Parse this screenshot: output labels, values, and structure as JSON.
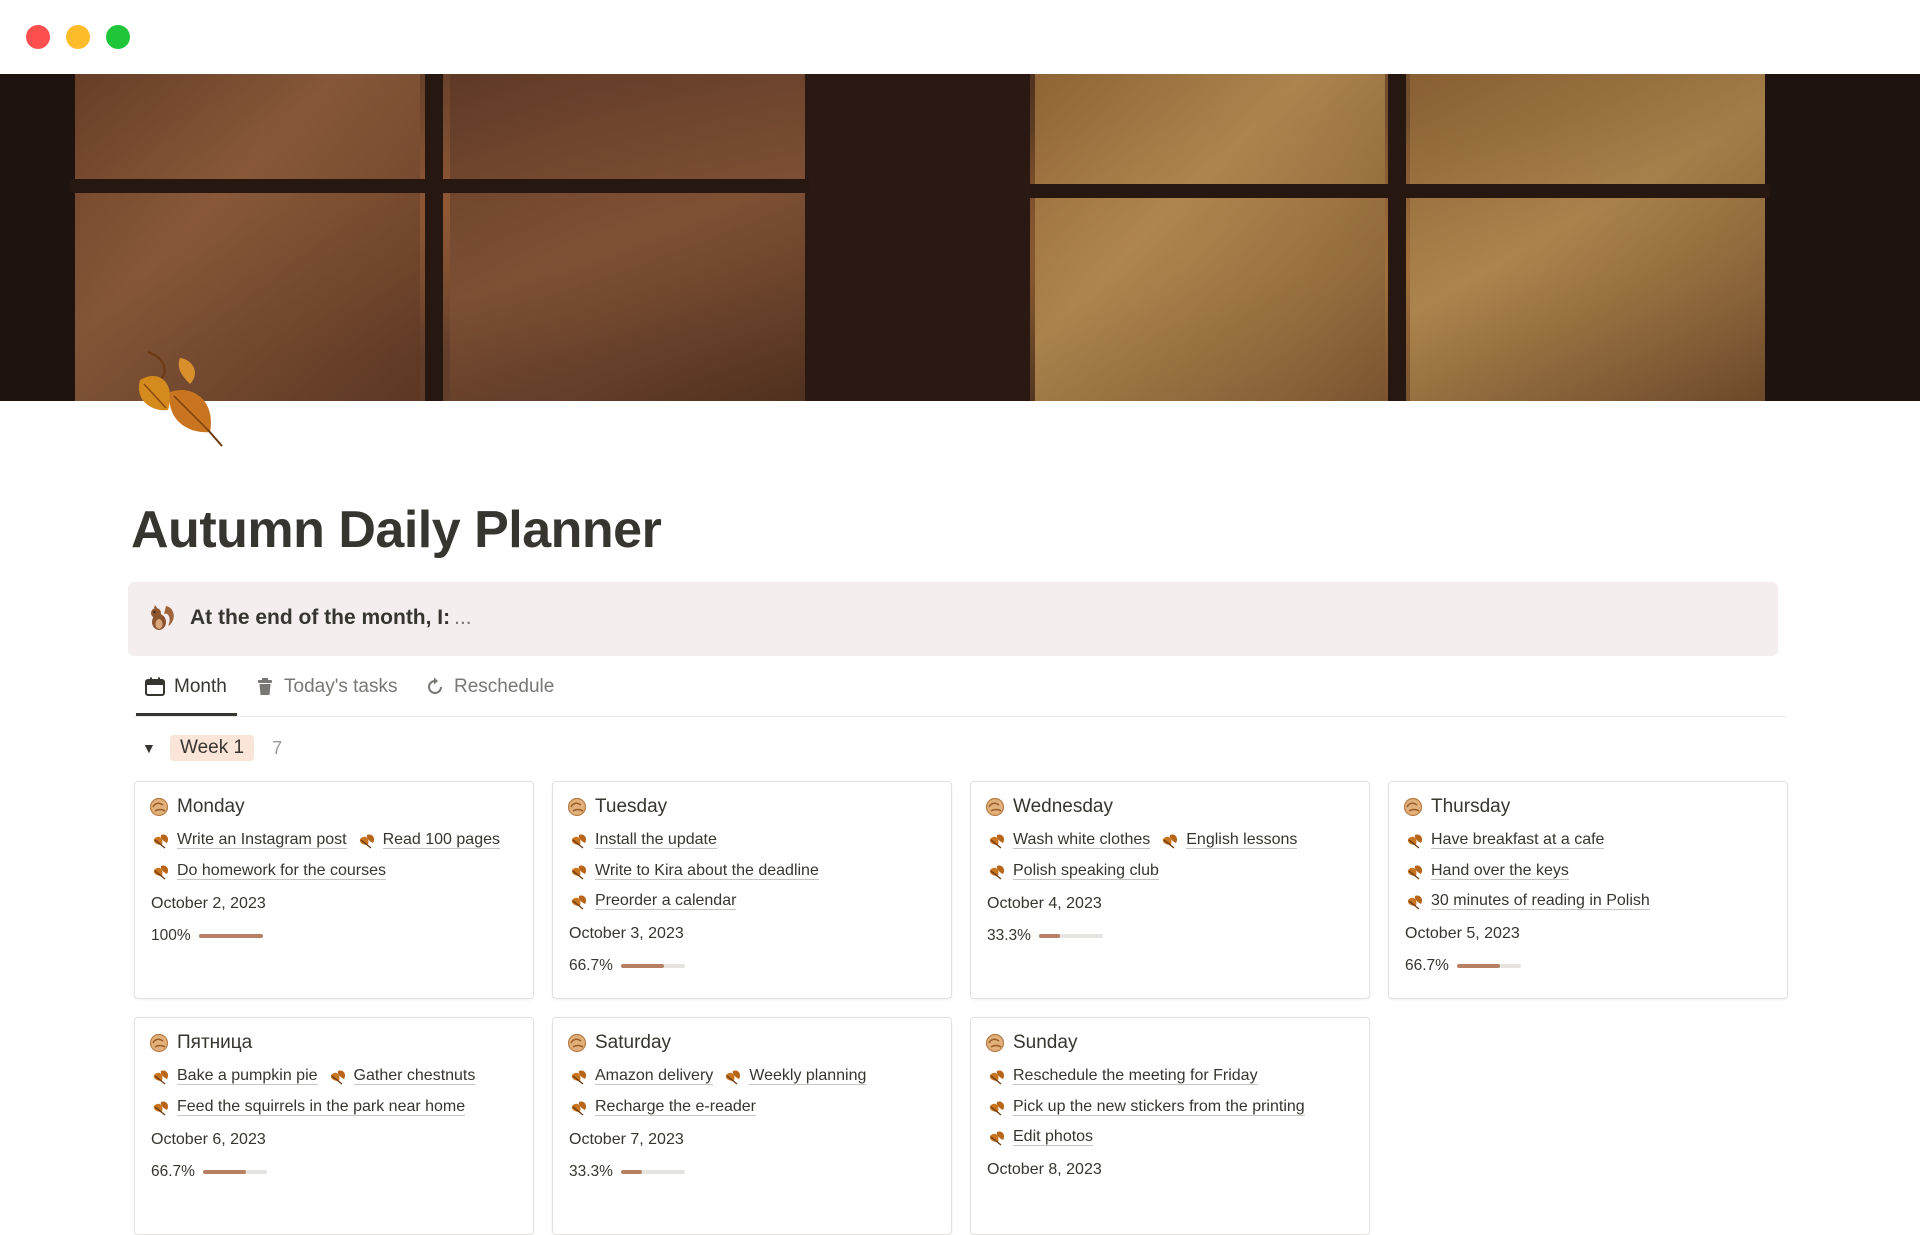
{
  "page": {
    "title": "Autumn Daily Planner",
    "icon": "autumn-leaves-icon"
  },
  "callout": {
    "icon": "squirrel-icon",
    "label": "At the end of the month, I:",
    "rest": "..."
  },
  "tabs": [
    {
      "label": "Month",
      "icon": "calendar-icon",
      "active": true
    },
    {
      "label": "Today's tasks",
      "icon": "trash-icon",
      "active": false
    },
    {
      "label": "Reschedule",
      "icon": "refresh-icon",
      "active": false
    }
  ],
  "group": {
    "label": "Week 1",
    "count": "7",
    "collapsed": false
  },
  "colors": {
    "accent": "#b78062",
    "pill": "#fbe4d8",
    "callout": "#f4eeee"
  },
  "cards": [
    {
      "title": "Monday",
      "tasks": [
        "Write an Instagram post",
        "Read 100 pages",
        "Do homework for the courses"
      ],
      "date": "October 2, 2023",
      "progress_label": "100%",
      "progress": 1.0
    },
    {
      "title": "Tuesday",
      "tasks": [
        "Install the update",
        "Write to Kira about the deadline",
        "Preorder a calendar"
      ],
      "date": "October 3, 2023",
      "progress_label": "66.7%",
      "progress": 0.667
    },
    {
      "title": "Wednesday",
      "tasks": [
        "Wash white clothes",
        "English lessons",
        "Polish speaking club"
      ],
      "date": "October 4, 2023",
      "progress_label": "33.3%",
      "progress": 0.333
    },
    {
      "title": "Thursday",
      "tasks": [
        "Have breakfast at a cafe",
        "Hand over the keys",
        "30 minutes of reading in Polish"
      ],
      "date": "October 5, 2023",
      "progress_label": "66.7%",
      "progress": 0.667
    },
    {
      "title": "Пятница",
      "tasks": [
        "Bake a pumpkin pie",
        "Gather chestnuts",
        "Feed the squirrels in the park near home"
      ],
      "date": "October 6, 2023",
      "progress_label": "66.7%",
      "progress": 0.667
    },
    {
      "title": "Saturday",
      "tasks": [
        "Amazon delivery",
        "Weekly planning",
        "Recharge the e-reader"
      ],
      "date": "October 7, 2023",
      "progress_label": "33.3%",
      "progress": 0.333
    },
    {
      "title": "Sunday",
      "tasks": [
        "Reschedule the meeting for Friday",
        "Pick up the new stickers from the printing",
        "Edit photos"
      ],
      "date": "October 8, 2023",
      "progress_label": "",
      "progress": null
    }
  ]
}
